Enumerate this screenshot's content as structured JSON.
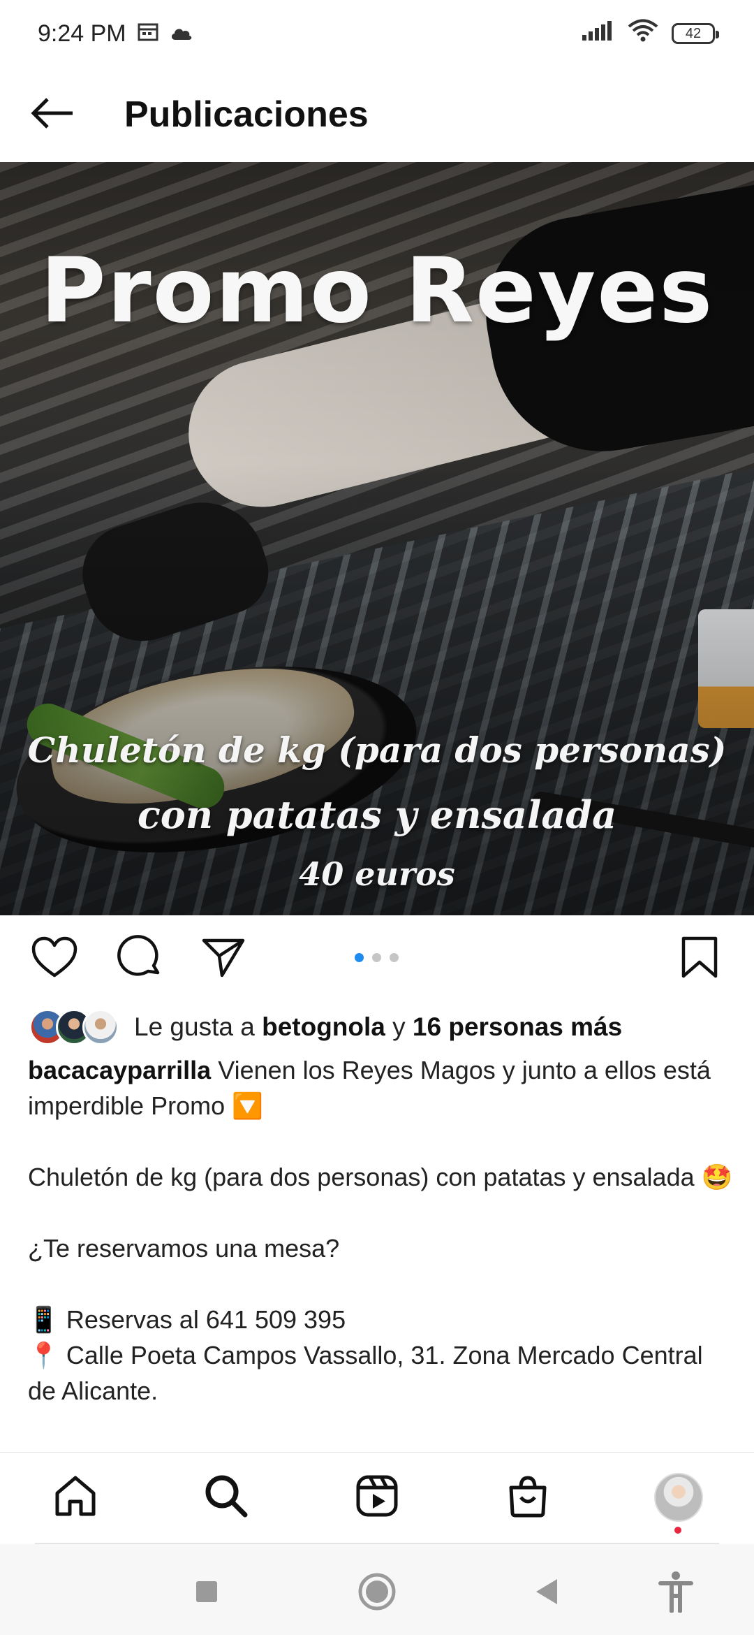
{
  "status_bar": {
    "time": "9:24 PM",
    "battery": "42",
    "icons": [
      "calendar-icon",
      "cloud-icon",
      "signal-icon",
      "wifi-icon",
      "battery-icon"
    ]
  },
  "app_bar": {
    "title": "Publicaciones",
    "back_icon": "back-arrow-icon"
  },
  "post": {
    "image": {
      "title": "Promo Reyes",
      "line1": "Chuletón de kg (para dos personas)",
      "line2": "con patatas y ensalada",
      "line3": "40 euros"
    },
    "carousel": {
      "count": 3,
      "active_index": 0
    },
    "actions": [
      "heart-icon",
      "comment-icon",
      "share-icon",
      "bookmark-icon"
    ],
    "likes": {
      "prefix": "Le gusta a",
      "user": "betognola",
      "connector": "y",
      "others": "16 personas más"
    },
    "caption": {
      "username": "bacacayparrilla",
      "intro": "Vienen los Reyes Magos y junto a ellos está imperdible Promo 🔽",
      "offer": "Chuletón de kg (para dos personas) con patatas y ensalada 🤩",
      "question": "¿Te reservamos una mesa?",
      "phone": "📱 Reservas al 641 509 395",
      "address": "📍 Calle Poeta Campos Vassallo, 31. Zona Mercado Central de Alicante."
    }
  },
  "bottom_nav": {
    "items": [
      "home-icon",
      "search-icon",
      "reels-icon",
      "shop-icon",
      "profile-avatar"
    ]
  },
  "system_nav": {
    "items": [
      "recents-square-icon",
      "home-circle-icon",
      "back-triangle-icon",
      "accessibility-icon"
    ]
  },
  "colors": {
    "accent_blue": "#1d8cf0",
    "notification_red": "#e8263f",
    "text_primary": "#111111"
  }
}
